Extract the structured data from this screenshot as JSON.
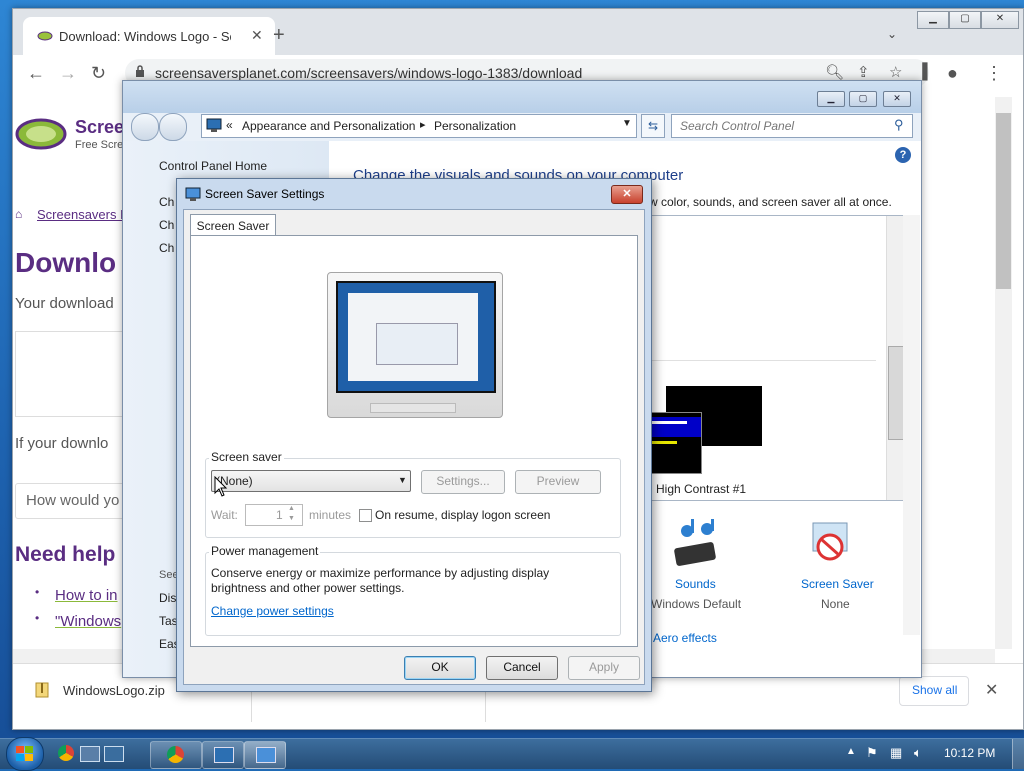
{
  "browser": {
    "tab_title": "Download: Windows Logo - Scre",
    "url": "screensaversplanet.com/screensavers/windows-logo-1383/download",
    "new_tab_icon": "plus-icon"
  },
  "webpage": {
    "site_title": "Scree",
    "site_subtitle": "Free Scre",
    "breadcrumb": "Screensavers P",
    "heading": "Downlo",
    "download_text": "Your download",
    "if_text": "If your downlo",
    "how_text": "How would yo",
    "help_heading": "Need help",
    "help_link_1": "How to in",
    "help_link_2": "\"Windows"
  },
  "download_shelf": {
    "file_name": "WindowsLogo.zip",
    "show_all": "Show all"
  },
  "control_panel": {
    "breadcrumb_prefix": "«",
    "breadcrumb_1": "Appearance and Personalization",
    "breadcrumb_sep": "▸",
    "breadcrumb_2": "Personalization",
    "search_placeholder": "Search Control Panel",
    "nav_home": "Control Panel Home",
    "nav_items": [
      "Ch",
      "Ch",
      "Ch"
    ],
    "see_also": "See",
    "see_also_items": [
      "Dis",
      "Tas",
      "Eas"
    ],
    "main_heading": "Change the visuals and sounds on your computer",
    "main_sub": "w color, sounds, and screen saver all at once.",
    "theme_label": "High Contrast #1",
    "sounds_label": "Sounds",
    "sounds_value": "Windows Default",
    "screensaver_label": "Screen Saver",
    "screensaver_value": "None",
    "aero_link": "Aero effects"
  },
  "dialog": {
    "title": "Screen Saver Settings",
    "tab": "Screen Saver",
    "group_screensaver": "Screen saver",
    "select_value": "(None)",
    "settings_btn": "Settings...",
    "preview_btn": "Preview",
    "wait_label": "Wait:",
    "wait_value": "1",
    "minutes_label": "minutes",
    "resume_label": "On resume, display logon screen",
    "group_power": "Power management",
    "power_text": "Conserve energy or maximize performance by adjusting display brightness and other power settings.",
    "power_link": "Change power settings",
    "ok_btn": "OK",
    "cancel_btn": "Cancel",
    "apply_btn": "Apply"
  },
  "taskbar": {
    "clock": "10:12 PM"
  },
  "colors": {
    "site_purple": "#5a2d82",
    "link_blue": "#1a0dab",
    "cp_link": "#0066cc"
  }
}
